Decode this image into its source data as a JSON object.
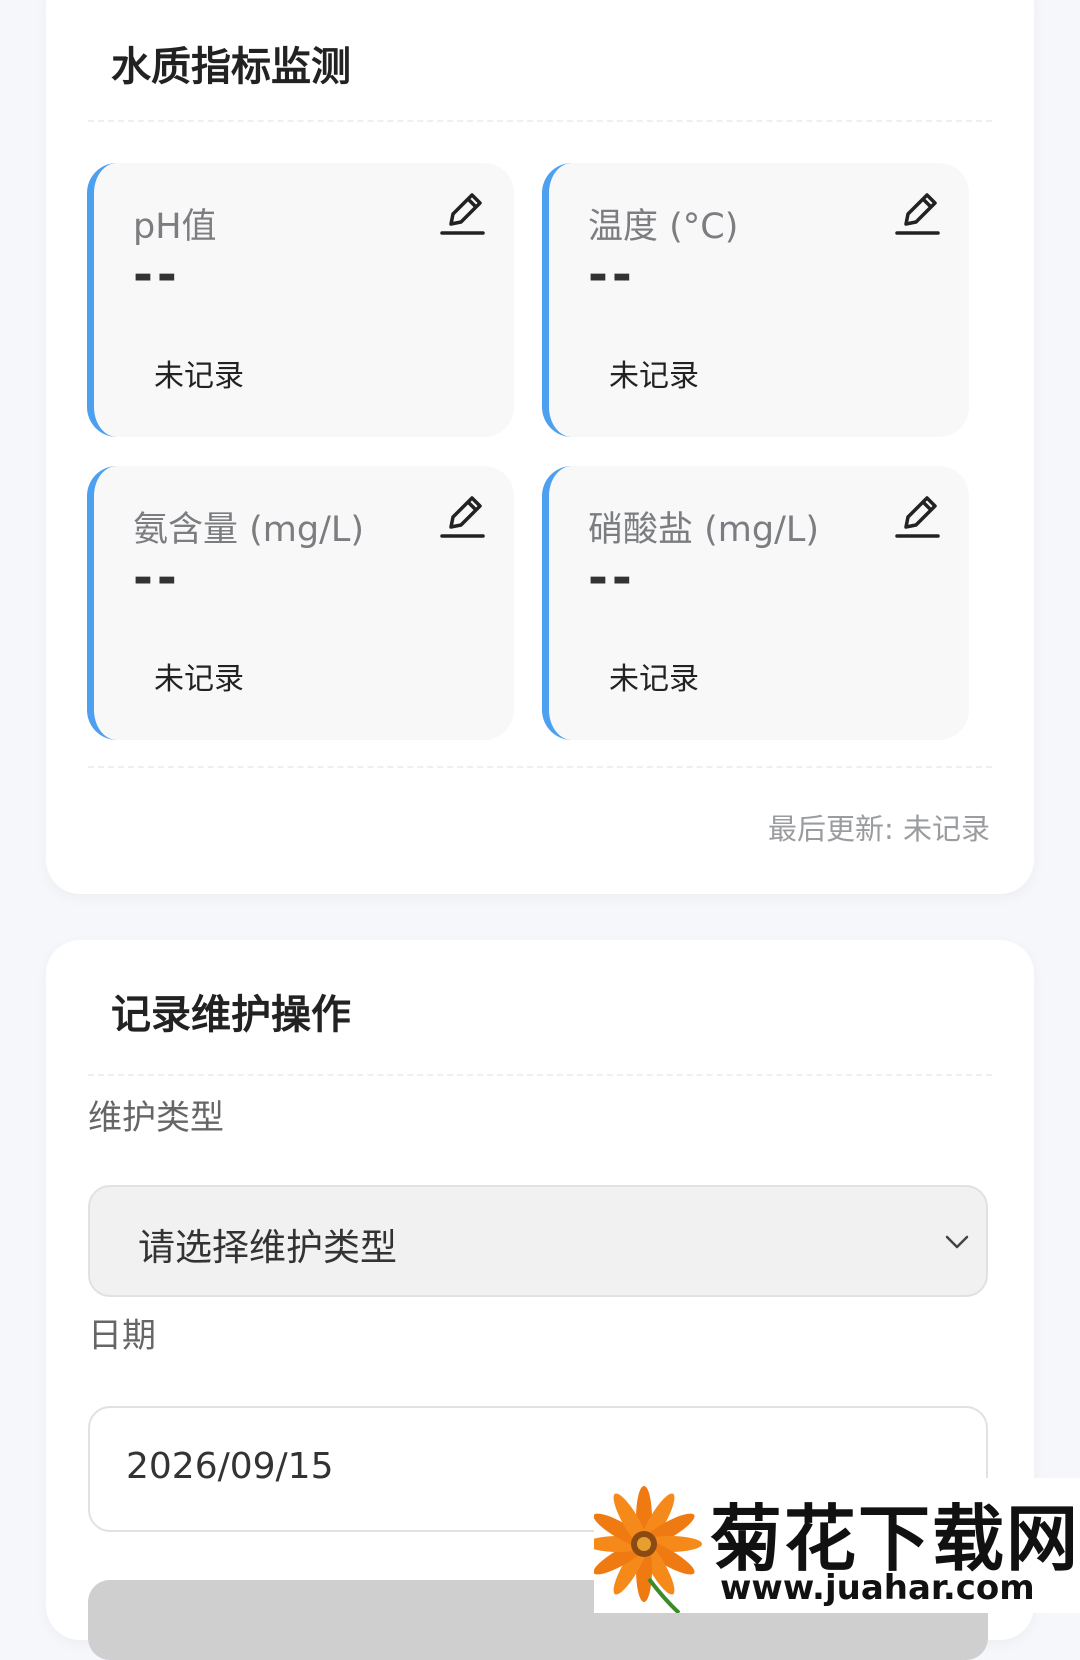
{
  "water_quality": {
    "title": "水质指标监测",
    "metrics": [
      {
        "label": "pH值",
        "value": "--",
        "status": "未记录"
      },
      {
        "label": "温度 (°C)",
        "value": "--",
        "status": "未记录"
      },
      {
        "label": "氨含量 (mg/L)",
        "value": "--",
        "status": "未记录"
      },
      {
        "label": "硝酸盐 (mg/L)",
        "value": "--",
        "status": "未记录"
      }
    ],
    "last_updated": "最后更新: 未记录"
  },
  "maintenance": {
    "title": "记录维护操作",
    "type_label": "维护类型",
    "type_placeholder": "请选择维护类型",
    "date_label": "日期",
    "date_value": "2026/09/15"
  },
  "watermark": {
    "title": "菊花下载网",
    "url": "www.juahar.com"
  },
  "colors": {
    "accent": "#4d9ff0",
    "card_background": "#ffffff",
    "page_background": "#f5f7fa"
  }
}
